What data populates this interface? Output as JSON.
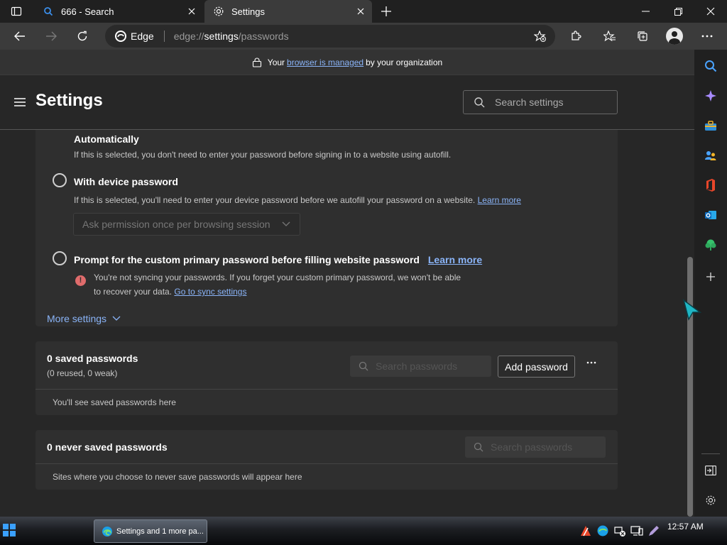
{
  "tabs": [
    {
      "label": "666 - Search",
      "icon": "search-icon"
    },
    {
      "label": "Settings",
      "icon": "gear-icon"
    }
  ],
  "address_bar": {
    "brand": "Edge",
    "url_prefix": "edge://",
    "url_bold": "settings",
    "url_suffix": "/passwords"
  },
  "managed_banner": {
    "prefix": "Your",
    "link": "browser is managed",
    "suffix": "by your organization"
  },
  "header": {
    "title": "Settings",
    "search_placeholder": "Search settings"
  },
  "options": {
    "automatic": {
      "title": "Automatically",
      "desc": "If this is selected, you don't need to enter your password before signing in to a website using autofill."
    },
    "device": {
      "title": "With device password",
      "desc": "If this is selected, you'll need to enter your device password before we autofill your password on a website.",
      "link": "Learn more",
      "dropdown": "Ask permission once per browsing session"
    },
    "custom": {
      "title": "Prompt for the custom primary password before filling website password",
      "link": "Learn more",
      "warning_line1": "You're not syncing your passwords. If you forget your custom primary password, we won't be able",
      "warning_line2": "to recover your data.",
      "warning_link": "Go to sync settings"
    },
    "more_settings": "More settings"
  },
  "saved": {
    "title": "0 saved passwords",
    "sub": "(0 reused, 0 weak)",
    "search_placeholder": "Search passwords",
    "add_button": "Add password",
    "empty": "You'll see saved passwords here"
  },
  "never_saved": {
    "title": "0 never saved passwords",
    "search_placeholder": "Search passwords",
    "empty": "Sites where you choose to never save passwords will appear here"
  },
  "taskbar": {
    "app_button": "Settings and 1 more pa...",
    "clock": "12:57 AM"
  },
  "colors": {
    "accent_link": "#8ab4f8",
    "warning_icon": "#e06c6c"
  }
}
